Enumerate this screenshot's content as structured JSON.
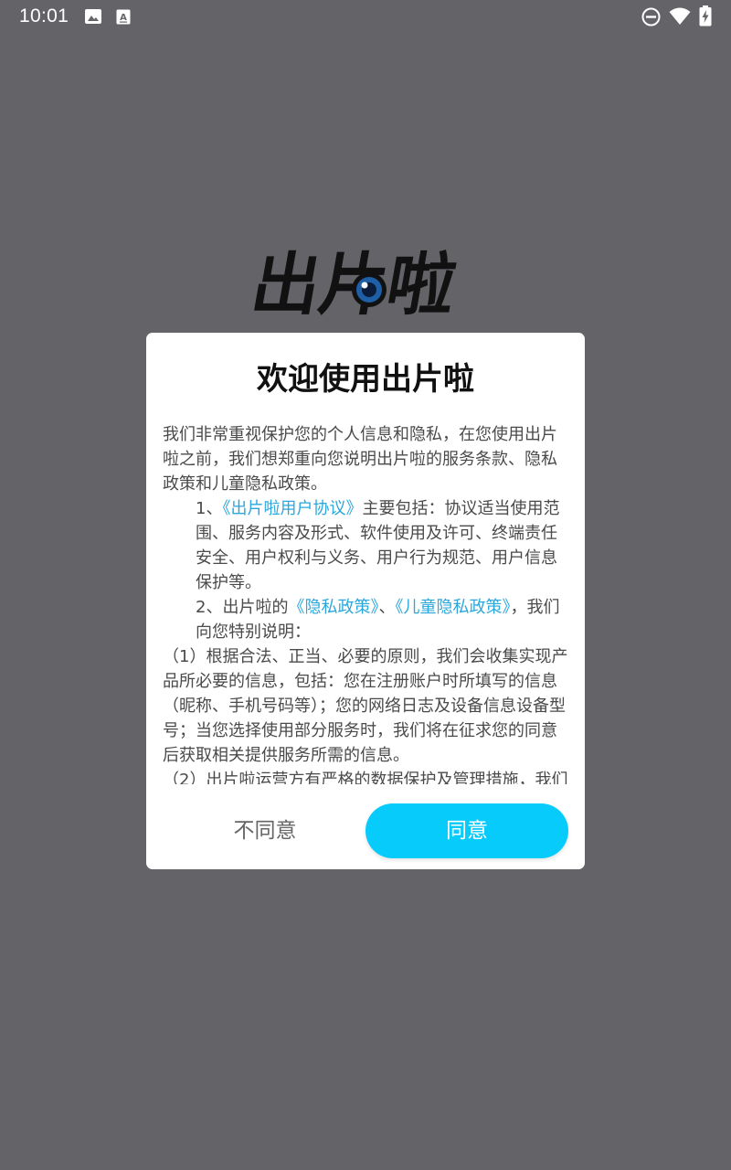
{
  "status_bar": {
    "time": "10:01",
    "icons": [
      "image-icon",
      "text-a-icon",
      "do-not-disturb-icon",
      "wifi-icon",
      "battery-charging-icon"
    ]
  },
  "app": {
    "logo_text": "出片啦",
    "logo_icon": "lens-eye-icon"
  },
  "dialog": {
    "title": "欢迎使用出片啦",
    "p1": "我们非常重视保护您的个人信息和隐私，在您使用出片啦之前，我们想郑重向您说明出片啦的服务条款、隐私政策和儿童隐私政策。",
    "p2_prefix": "1、",
    "p2_link": "《出片啦用户协议》",
    "p2_suffix": "主要包括：协议适当使用范围、服务内容及形式、软件使用及许可、终端责任安全、用户权利与义务、用户行为规范、用户信息保护等。",
    "p3_prefix": "2、出片啦的",
    "p3_link1": "《隐私政策》",
    "p3_sep": "、",
    "p3_link2": "《儿童隐私政策》",
    "p3_suffix": "，我们向您特别说明：",
    "p4": "（1）根据合法、正当、必要的原则，我们会收集实现产品所必要的信息，包括：您在注册账户时所填写的信息（昵称、手机号码等）；您的网络日志及设备信息设备型号；当您选择使用部分服务时，我们将在征求您的同意后获取相关提供服务所需的信息。",
    "p5": "（2）出片啦运营方有严格的数据保护及管理措施，我们",
    "disagree_label": "不同意",
    "agree_label": "同意"
  },
  "colors": {
    "background": "#646368",
    "link": "#2aa7dc",
    "accent": "#07cbfb"
  }
}
